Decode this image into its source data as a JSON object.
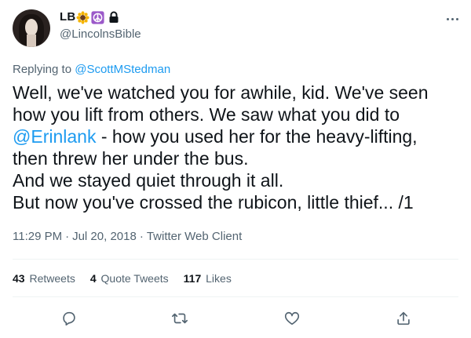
{
  "author": {
    "display_name": "LB",
    "handle": "@LincolnsBible",
    "badges": [
      "sunflower-emoji",
      "peace-symbol-emoji",
      "lock-icon"
    ]
  },
  "reply": {
    "prefix": "Replying to",
    "to": "@ScottMStedman"
  },
  "tweet": {
    "lines": [
      "Well, we've watched you for awhile, kid. We've seen",
      "how you lift from others. We saw what you did to",
      {
        "mention": "@Erinlank",
        "rest": " - how you used her for the heavy-lifting,"
      },
      "then threw her under the bus.",
      "And we stayed quiet through it all.",
      "But now you've crossed the rubicon, little thief... /1"
    ],
    "time": "11:29 PM",
    "date": "Jul 20, 2018",
    "client": "Twitter Web Client",
    "sep": "·"
  },
  "stats": {
    "retweets_count": "43",
    "retweets_label": "Retweets",
    "quotes_count": "4",
    "quotes_label": "Quote Tweets",
    "likes_count": "117",
    "likes_label": "Likes"
  },
  "colors": {
    "link": "#1d9bf0",
    "secondary": "#536471",
    "text": "#0f1419"
  },
  "icons": [
    "more-icon",
    "reply-icon",
    "retweet-icon",
    "like-icon",
    "share-icon"
  ]
}
